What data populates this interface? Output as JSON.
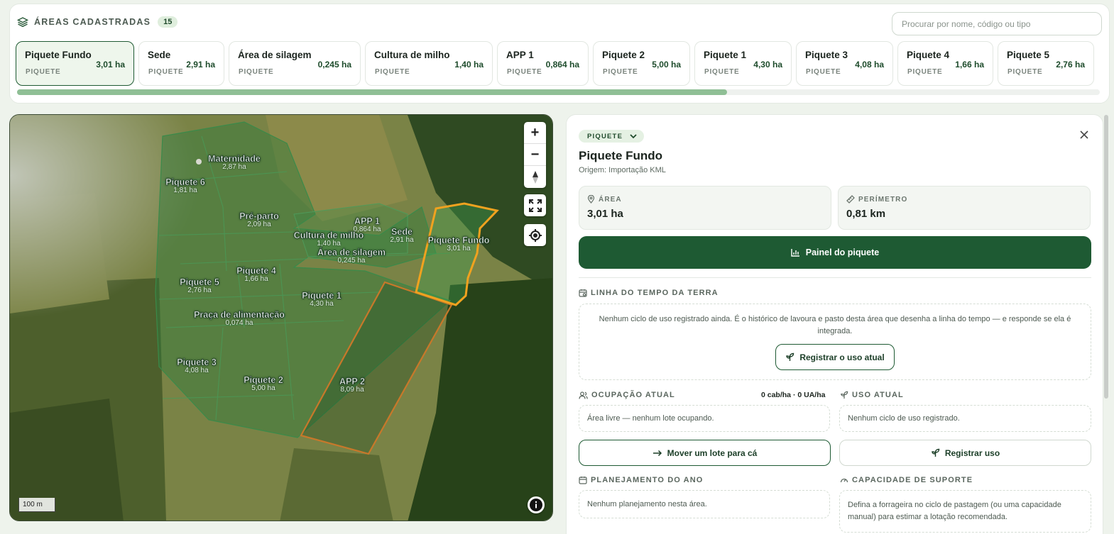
{
  "header": {
    "title": "ÁREAS CADASTRADAS",
    "count": "15",
    "search_placeholder": "Procurar por nome, código ou tipo"
  },
  "areas": [
    {
      "name": "Piquete Fundo",
      "type": "PIQUETE",
      "area": "3,01 ha"
    },
    {
      "name": "Sede",
      "type": "PIQUETE",
      "area": "2,91 ha"
    },
    {
      "name": "Área de silagem",
      "type": "PIQUETE",
      "area": "0,245 ha"
    },
    {
      "name": "Cultura de milho",
      "type": "PIQUETE",
      "area": "1,40 ha"
    },
    {
      "name": "APP 1",
      "type": "PIQUETE",
      "area": "0,864 ha"
    },
    {
      "name": "Piquete 2",
      "type": "PIQUETE",
      "area": "5,00 ha"
    },
    {
      "name": "Piquete 1",
      "type": "PIQUETE",
      "area": "4,30 ha"
    },
    {
      "name": "Piquete 3",
      "type": "PIQUETE",
      "area": "4,08 ha"
    },
    {
      "name": "Piquete 4",
      "type": "PIQUETE",
      "area": "1,66 ha"
    },
    {
      "name": "Piquete 5",
      "type": "PIQUETE",
      "area": "2,76 ha"
    }
  ],
  "map": {
    "labels": [
      {
        "name": "Maternidade",
        "area": "2,87 ha"
      },
      {
        "name": "Piquete 6",
        "area": "1,81 ha"
      },
      {
        "name": "Pré-parto",
        "area": "2,09 ha"
      },
      {
        "name": "APP 1",
        "area": "0,864 ha"
      },
      {
        "name": "Cultura de milho",
        "area": "1,40 ha"
      },
      {
        "name": "Sede",
        "area": "2,91 ha"
      },
      {
        "name": "Piquete Fundo",
        "area": "3,01 ha"
      },
      {
        "name": "Área de silagem",
        "area": "0,245 ha"
      },
      {
        "name": "Piquete 5",
        "area": "2,76 ha"
      },
      {
        "name": "Piquete 4",
        "area": "1,66 ha"
      },
      {
        "name": "Piquete 1",
        "area": "4,30 ha"
      },
      {
        "name": "Praça de alimentação",
        "area": "0,074 ha"
      },
      {
        "name": "Piquete 3",
        "area": "4,08 ha"
      },
      {
        "name": "Piquete 2",
        "area": "5,00 ha"
      },
      {
        "name": "APP 2",
        "area": "8,09 ha"
      }
    ],
    "scale": "100 m",
    "zoom_in": "+",
    "zoom_out": "−"
  },
  "detail": {
    "type_pill": "PIQUETE",
    "title": "Piquete Fundo",
    "origin": "Origem: Importação KML",
    "area_label": "ÁREA",
    "area_value": "3,01 ha",
    "perimeter_label": "PERÍMETRO",
    "perimeter_value": "0,81 km",
    "panel_button": "Painel do piquete",
    "timeline_title": "LINHA DO TEMPO DA TERRA",
    "timeline_empty": "Nenhum ciclo de uso registrado ainda. É o histórico de lavoura e pasto desta área que desenha a linha do tempo — e responde se ela é integrada.",
    "register_current_use": "Registrar o uso atual",
    "occupation_title": "OCUPAÇÃO ATUAL",
    "occupation_stats": "0 cab/ha · 0 UA/ha",
    "occupation_empty": "Área livre — nenhum lote ocupando.",
    "current_use_title": "USO ATUAL",
    "current_use_empty": "Nenhum ciclo de uso registrado.",
    "move_lot_button": "Mover um lote para cá",
    "register_use_button": "Registrar uso",
    "planning_title": "PLANEJAMENTO DO ANO",
    "planning_empty": "Nenhum planejamento nesta área.",
    "capacity_title": "CAPACIDADE DE SUPORTE",
    "capacity_text": "Defina a forrageira no ciclo de pastagem (ou uma capacidade manual) para estimar a lotação recomendada."
  },
  "colors": {
    "brand_green": "#1e5a33",
    "selected_outline": "#f0a21f",
    "app2_outline": "#c8782a"
  }
}
